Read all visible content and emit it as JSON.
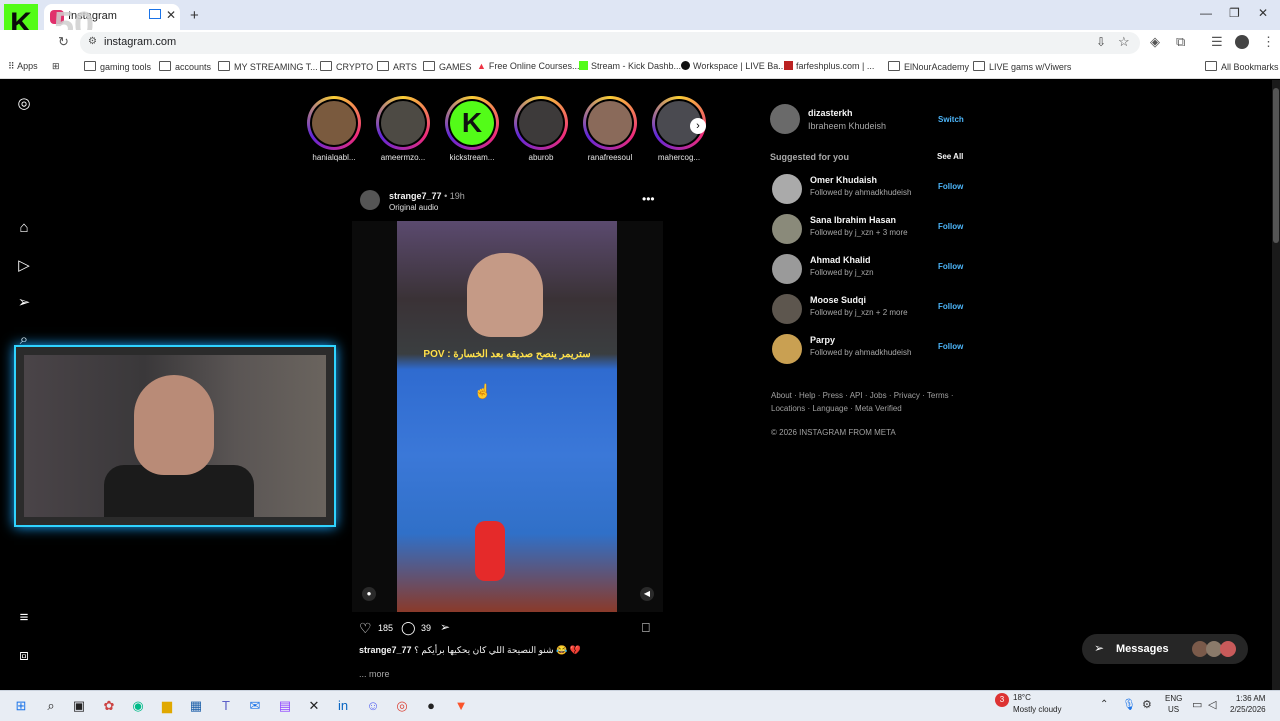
{
  "browser": {
    "tab_title": "Instagram",
    "url": "instagram.com",
    "bookmarks": [
      "Apps",
      "gaming tools",
      "accounts",
      "MY STREAMING T...",
      "CRYPTO",
      "ARTS",
      "GAMES",
      "Free Online Courses...",
      "Stream - Kick Dashb...",
      "Workspace | LIVE Ba...",
      "farfeshplus.com | ...",
      "ElNourAcademy",
      "LIVE gams w/Viwers",
      "All Bookmarks"
    ]
  },
  "overlay": {
    "kick_count": "50"
  },
  "stories": [
    {
      "name": "hanialqabl..."
    },
    {
      "name": "ameermzo..."
    },
    {
      "name": "kickstream..."
    },
    {
      "name": "aburob"
    },
    {
      "name": "ranafreesoul"
    },
    {
      "name": "mahercog..."
    }
  ],
  "post": {
    "username": "strange7_77",
    "time": "19h",
    "audio": "Original audio",
    "video_caption": "POV : ستريمر ينصح صديقه بعد الخسارة",
    "likes": "185",
    "comments": "39",
    "caption_user": "strange7_77",
    "caption_text": "شنو النصيحة اللي كان يحكيها برأيكم ؟ 😂 💔",
    "more": "... more"
  },
  "profile": {
    "username": "dizasterkh",
    "full_name": "Ibraheem Khudeish",
    "switch_label": "Switch"
  },
  "suggested": {
    "title": "Suggested for you",
    "see_all": "See All",
    "follow_label": "Follow",
    "items": [
      {
        "name": "Omer Khudaish",
        "sub": "Followed by ahmadkhudeish"
      },
      {
        "name": "Sana Ibrahim Hasan",
        "sub": "Followed by j_xzn + 3 more"
      },
      {
        "name": "Ahmad Khalid",
        "sub": "Followed by j_xzn"
      },
      {
        "name": "Moose Sudqi",
        "sub": "Followed by j_xzn + 2 more"
      },
      {
        "name": "Parpy",
        "sub": "Followed by ahmadkhudeish"
      }
    ]
  },
  "footer": {
    "line1": "About · Help · Press · API · Jobs · Privacy · Terms ·",
    "line2": "Locations · Language · Meta Verified",
    "copyright": "© 2026 INSTAGRAM FROM META"
  },
  "messages_label": "Messages",
  "taskbar": {
    "weather_temp": "18°C",
    "weather_desc": "Mostly cloudy",
    "lang": "ENG",
    "region": "US",
    "time": "1:36 AM",
    "date": "2/25/2026",
    "notif_badge": "3"
  }
}
